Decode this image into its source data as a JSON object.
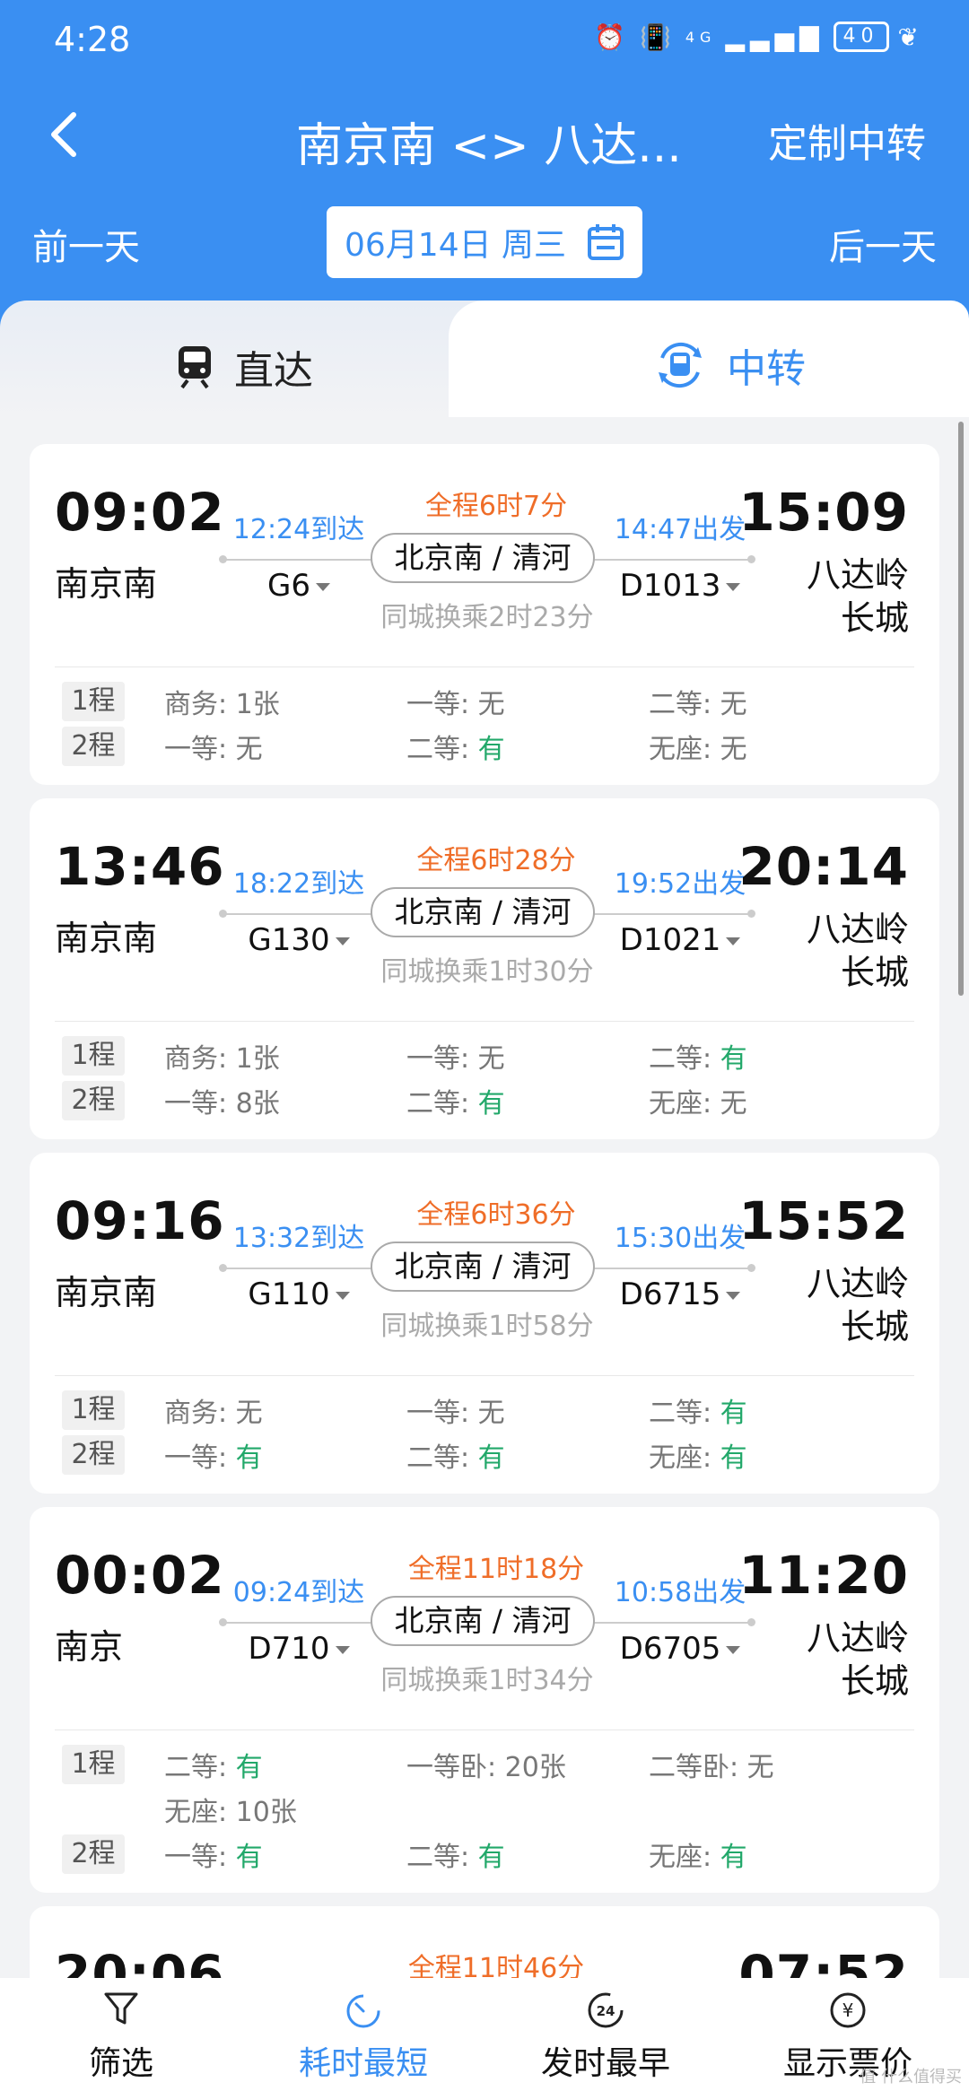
{
  "status": {
    "time": "4:28",
    "battery": "40",
    "signal": "4G"
  },
  "nav": {
    "title": "南京南 <> 八达...",
    "custom_label": "定制中转"
  },
  "date_bar": {
    "prev": "前一天",
    "date": "06月14日 周三",
    "next": "后一天"
  },
  "tabs": {
    "direct": "直达",
    "transfer": "中转"
  },
  "cards": [
    {
      "dep_time": "09:02",
      "dep_station": "南京南",
      "arr_time": "15:09",
      "arr_station": "八达岭长城",
      "total": "全程6时7分",
      "arrive_at": "12:24到达",
      "depart_at": "14:47出发",
      "train1": "G6",
      "train2": "D1013",
      "transfer_station": "北京南 / 清河",
      "transfer_wait": "同城换乘2时23分",
      "legs": [
        {
          "label": "1程",
          "rows": [
            [
              {
                "k": "商务: ",
                "v": "1张",
                "has": false
              },
              {
                "k": "一等: ",
                "v": "无",
                "has": false
              },
              {
                "k": "二等: ",
                "v": "无",
                "has": false
              }
            ]
          ]
        },
        {
          "label": "2程",
          "rows": [
            [
              {
                "k": "一等: ",
                "v": "无",
                "has": false
              },
              {
                "k": "二等: ",
                "v": "有",
                "has": true
              },
              {
                "k": "无座: ",
                "v": "无",
                "has": false
              }
            ]
          ]
        }
      ]
    },
    {
      "dep_time": "13:46",
      "dep_station": "南京南",
      "arr_time": "20:14",
      "arr_station": "八达岭长城",
      "total": "全程6时28分",
      "arrive_at": "18:22到达",
      "depart_at": "19:52出发",
      "train1": "G130",
      "train2": "D1021",
      "transfer_station": "北京南 / 清河",
      "transfer_wait": "同城换乘1时30分",
      "legs": [
        {
          "label": "1程",
          "rows": [
            [
              {
                "k": "商务: ",
                "v": "1张",
                "has": false
              },
              {
                "k": "一等: ",
                "v": "无",
                "has": false
              },
              {
                "k": "二等: ",
                "v": "有",
                "has": true
              }
            ]
          ]
        },
        {
          "label": "2程",
          "rows": [
            [
              {
                "k": "一等: ",
                "v": "8张",
                "has": false
              },
              {
                "k": "二等: ",
                "v": "有",
                "has": true
              },
              {
                "k": "无座: ",
                "v": "无",
                "has": false
              }
            ]
          ]
        }
      ]
    },
    {
      "dep_time": "09:16",
      "dep_station": "南京南",
      "arr_time": "15:52",
      "arr_station": "八达岭长城",
      "total": "全程6时36分",
      "arrive_at": "13:32到达",
      "depart_at": "15:30出发",
      "train1": "G110",
      "train2": "D6715",
      "transfer_station": "北京南 / 清河",
      "transfer_wait": "同城换乘1时58分",
      "legs": [
        {
          "label": "1程",
          "rows": [
            [
              {
                "k": "商务: ",
                "v": "无",
                "has": false
              },
              {
                "k": "一等: ",
                "v": "无",
                "has": false
              },
              {
                "k": "二等: ",
                "v": "有",
                "has": true
              }
            ]
          ]
        },
        {
          "label": "2程",
          "rows": [
            [
              {
                "k": "一等: ",
                "v": "有",
                "has": true
              },
              {
                "k": "二等: ",
                "v": "有",
                "has": true
              },
              {
                "k": "无座: ",
                "v": "有",
                "has": true
              }
            ]
          ]
        }
      ]
    },
    {
      "dep_time": "00:02",
      "dep_station": "南京",
      "arr_time": "11:20",
      "arr_station": "八达岭长城",
      "total": "全程11时18分",
      "arrive_at": "09:24到达",
      "depart_at": "10:58出发",
      "train1": "D710",
      "train2": "D6705",
      "transfer_station": "北京南 / 清河",
      "transfer_wait": "同城换乘1时34分",
      "legs": [
        {
          "label": "1程",
          "rows": [
            [
              {
                "k": "二等: ",
                "v": "有",
                "has": true
              },
              {
                "k": "一等卧: ",
                "v": "20张",
                "has": false
              },
              {
                "k": "二等卧: ",
                "v": "无",
                "has": false
              }
            ],
            [
              {
                "k": "无座: ",
                "v": "10张",
                "has": false
              }
            ]
          ]
        },
        {
          "label": "2程",
          "rows": [
            [
              {
                "k": "一等: ",
                "v": "有",
                "has": true
              },
              {
                "k": "二等: ",
                "v": "有",
                "has": true
              },
              {
                "k": "无座: ",
                "v": "有",
                "has": true
              }
            ]
          ]
        }
      ]
    },
    {
      "dep_time": "20:06",
      "arr_time": "07:52",
      "total": "全程11时46分"
    }
  ],
  "tabbar": [
    {
      "label": "筛选",
      "icon": "filter-icon",
      "active": false
    },
    {
      "label": "耗时最短",
      "icon": "timer-icon",
      "active": true
    },
    {
      "label": "发时最早",
      "icon": "24h-icon",
      "active": false
    },
    {
      "label": "显示票价",
      "icon": "yen-icon",
      "active": false
    }
  ],
  "watermark": "值 什么值得买",
  "colors": {
    "primary": "#3a8ff2",
    "orange": "#ef6d28",
    "green": "#22a86a"
  }
}
